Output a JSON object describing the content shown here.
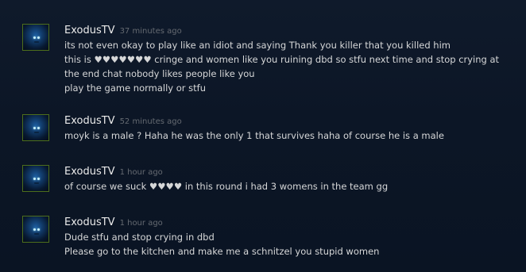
{
  "comments": [
    {
      "author": "ExodusTV",
      "timestamp": "37 minutes ago",
      "text": "its not even okay to play like an idiot and saying Thank you killer that you killed him\nthis is ♥♥♥♥♥♥♥ cringe and women like you ruining dbd so stfu next time and stop crying at\nthe end chat nobody likes people like you\nplay the game normally or stfu",
      "avatar": "user-avatar"
    },
    {
      "author": "ExodusTV",
      "timestamp": "52 minutes ago",
      "text": "moyk is a male ? Haha he was the only 1 that survives haha of course he is a male",
      "avatar": "user-avatar"
    },
    {
      "author": "ExodusTV",
      "timestamp": "1 hour ago",
      "text": "of course we suck ♥♥♥♥ in this round i had 3 womens in the team gg",
      "avatar": "user-avatar"
    },
    {
      "author": "ExodusTV",
      "timestamp": "1 hour ago",
      "text": "Dude stfu and stop crying in dbd\nPlease go to the kitchen and make me a schnitzel you stupid women",
      "avatar": "user-avatar"
    }
  ],
  "colors": {
    "background": "#0c1626",
    "author": "#ebebeb",
    "timestamp": "#656a71",
    "text": "#d6d7d8",
    "avatar_border": "#4d6e1c"
  }
}
